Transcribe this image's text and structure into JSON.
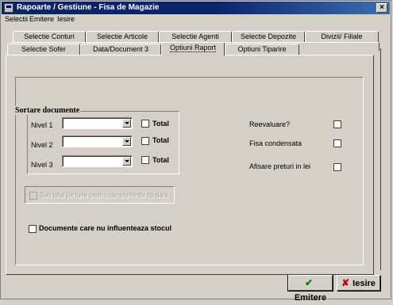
{
  "window": {
    "title": "Rapoarte / Gestiune - Fisa de Magazie"
  },
  "menu": {
    "items": [
      "Selectii",
      "Emitere",
      "Iesire"
    ]
  },
  "tabs_row1": [
    "Selectie Conturi",
    "Selectie Articole",
    "Selectie Agenti",
    "Selectie Depozite",
    "Divizii/ Filiale"
  ],
  "tabs_row2": [
    "Selectie Sofer",
    "Data/Document 3",
    "Optiuni Raport",
    "Optiuni Tiparire"
  ],
  "active_tab": "Optiuni Raport",
  "sortare": {
    "title": "Sortare documente",
    "levels": [
      {
        "label": "Nivel 1",
        "value": "",
        "total_label": "Total",
        "total_checked": false
      },
      {
        "label": "Nivel 2",
        "value": "",
        "total_label": "Total",
        "total_checked": false
      },
      {
        "label": "Nivel 3",
        "value": "",
        "total_label": "Total",
        "total_checked": false
      }
    ]
  },
  "subtotal": {
    "label": "Sub total pe luna pentru campurile de tip data",
    "checked": false,
    "enabled": false
  },
  "documente": {
    "label": "Documente care nu influenteaza stocul",
    "checked": false
  },
  "options": [
    {
      "label": "Reevaluare?",
      "checked": false
    },
    {
      "label": "Fisa condensata",
      "checked": false
    },
    {
      "label": "Afisare  preturi  in lei",
      "checked": false
    }
  ],
  "buttons": {
    "emitere": "Emitere",
    "iesire": "Iesire"
  },
  "colors": {
    "titlebar": "#0a246a",
    "face": "#d4d0c8",
    "emitere_icon": "#008000",
    "iesire_icon": "#cc0000"
  }
}
